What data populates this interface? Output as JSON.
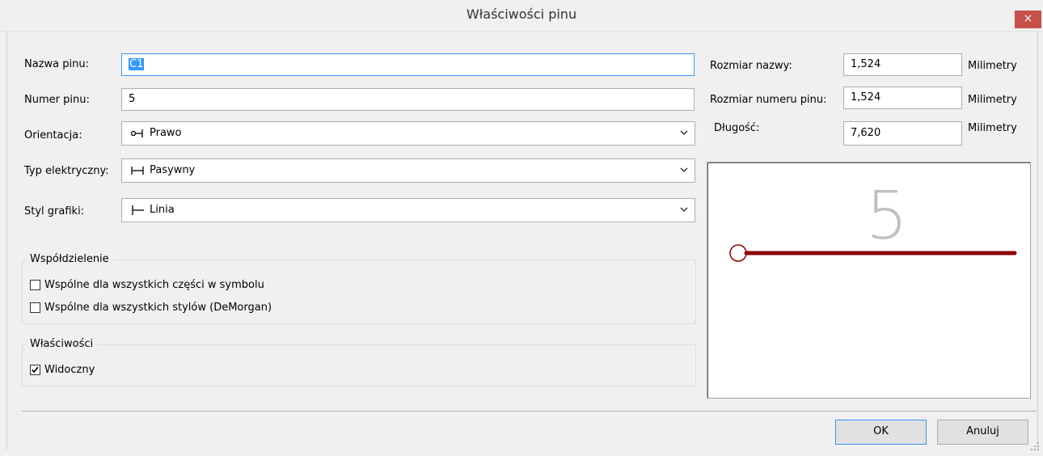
{
  "window": {
    "title": "Właściwości pinu",
    "close_glyph": "×"
  },
  "fields": {
    "pin_name_label": "Nazwa pinu:",
    "pin_name_value": "C1",
    "pin_number_label": "Numer pinu:",
    "pin_number_value": "5",
    "orientation_label": "Orientacja:",
    "orientation_value": "Prawo",
    "orientation_icon": "pin-right-icon",
    "electrical_type_label": "Typ elektryczny:",
    "electrical_type_value": "Pasywny",
    "electrical_type_icon": "passive-pin-icon",
    "graphic_style_label": "Styl grafiki:",
    "graphic_style_value": "Linia",
    "graphic_style_icon": "line-style-icon"
  },
  "sizes": {
    "name_size_label": "Rozmiar nazwy:",
    "name_size_value": "1,524",
    "name_size_unit": "Milimetry",
    "number_size_label": "Rozmiar numeru pinu:",
    "number_size_value": "1,524",
    "number_size_unit": "Milimetry",
    "length_label": "Długość:",
    "length_value": "7,620",
    "length_unit": "Milimetry"
  },
  "sharing": {
    "title": "Współdzielenie",
    "common_units_label": "Wspólne dla wszystkich części w symbolu",
    "common_units_checked": false,
    "common_convert_label": "Wspólne dla wszystkich stylów (DeMorgan)",
    "common_convert_checked": false
  },
  "properties": {
    "title": "Właściwości",
    "visible_label": "Widoczny",
    "visible_checked": true
  },
  "preview": {
    "pin_number_text": "5",
    "pin_color": "#8b0000",
    "number_color": "#c0c0c0"
  },
  "buttons": {
    "ok": "OK",
    "cancel": "Anuluj"
  }
}
